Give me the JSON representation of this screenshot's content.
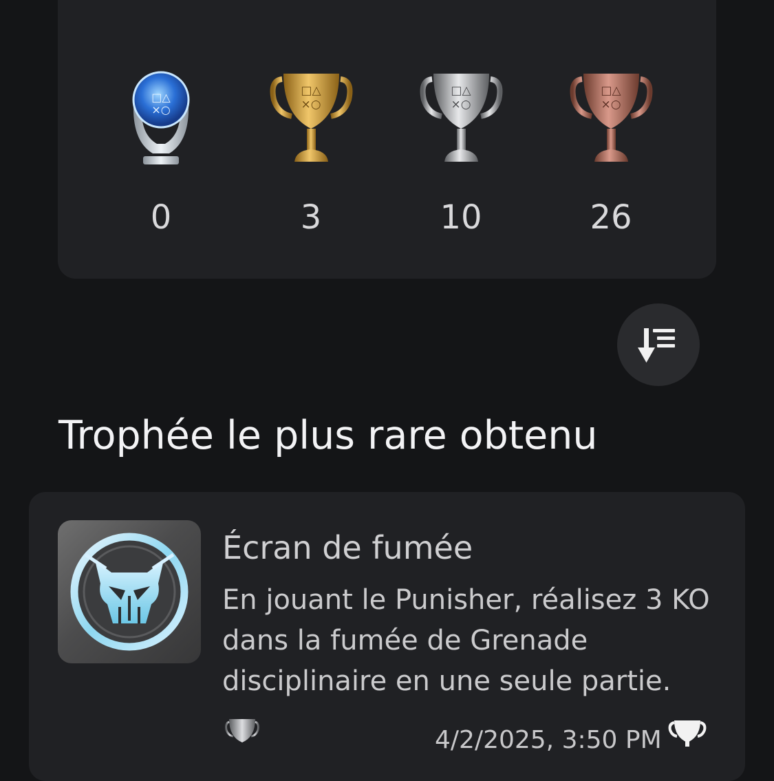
{
  "summary": {
    "trophies": [
      {
        "grade": "platinum",
        "count": "0"
      },
      {
        "grade": "gold",
        "count": "3"
      },
      {
        "grade": "silver",
        "count": "10"
      },
      {
        "grade": "bronze",
        "count": "26"
      }
    ]
  },
  "sort_button": {
    "icon": "sort-descending-icon"
  },
  "rarest_section": {
    "title": "Trophée le plus rare obtenu"
  },
  "rarest_trophy": {
    "name": "Écran de fumée",
    "description": "En jouant le Punisher, réalisez 3 KO dans la fumée de Grenade disciplinaire en une seule partie.",
    "grade": "silver",
    "earned_date": "4/2/2025, 3:50 PM",
    "earned_icon": "trophy-earned-icon"
  },
  "colors": {
    "background": "#141517",
    "card": "#202124",
    "gold": "#c99a3c",
    "silver": "#b3b3b6",
    "bronze": "#b87766",
    "platinum": "#3a7de0"
  }
}
